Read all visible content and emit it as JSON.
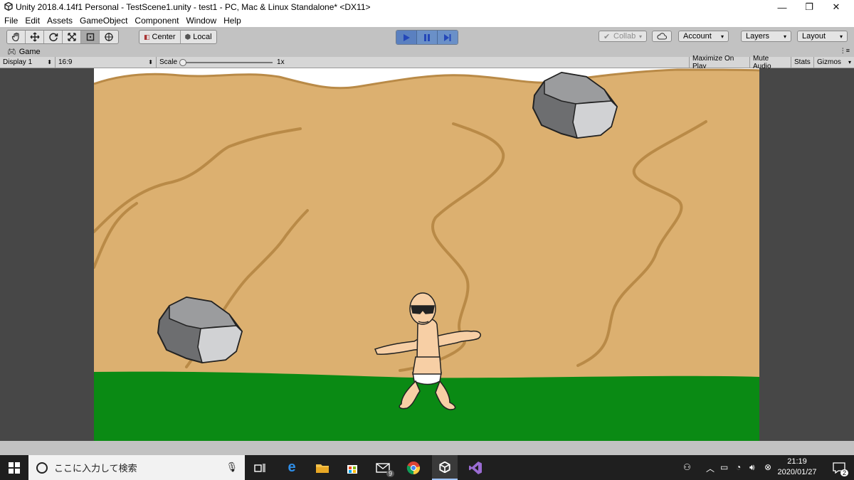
{
  "window": {
    "title": "Unity 2018.4.14f1 Personal - TestScene1.unity - test1 - PC, Mac & Linux Standalone* <DX11>",
    "minimize": "—",
    "restore": "❐",
    "close": "✕"
  },
  "menu": [
    "File",
    "Edit",
    "Assets",
    "GameObject",
    "Component",
    "Window",
    "Help"
  ],
  "toolbar": {
    "transform_tools": [
      "hand-icon",
      "move-icon",
      "rotate-icon",
      "scale-icon",
      "rect-icon",
      "transform-icon"
    ],
    "pivot": "Center",
    "space": "Local",
    "collab": "Collab",
    "account": "Account",
    "layers": "Layers",
    "layout": "Layout"
  },
  "game_tab": {
    "label": "Game",
    "display": "Display 1",
    "aspect": "16:9",
    "scale_label": "Scale",
    "scale_value": "1x",
    "scale_level": 0.0,
    "maximize": "Maximize On Play",
    "mute": "Mute Audio",
    "stats": "Stats",
    "gizmos": "Gizmos"
  },
  "scene": {
    "sky": "#ffffff",
    "cliff": "#dcb070",
    "cliff_line": "#b98a47",
    "grass": "#0a8a14",
    "rock_dark": "#6d6e70",
    "rock_mid": "#9b9c9e",
    "rock_light": "#d1d2d4"
  },
  "taskbar": {
    "search_placeholder": "ここに入力して検索",
    "mail_badge": "9",
    "time": "21:19",
    "date": "2020/01/27",
    "notification_count": "2"
  }
}
